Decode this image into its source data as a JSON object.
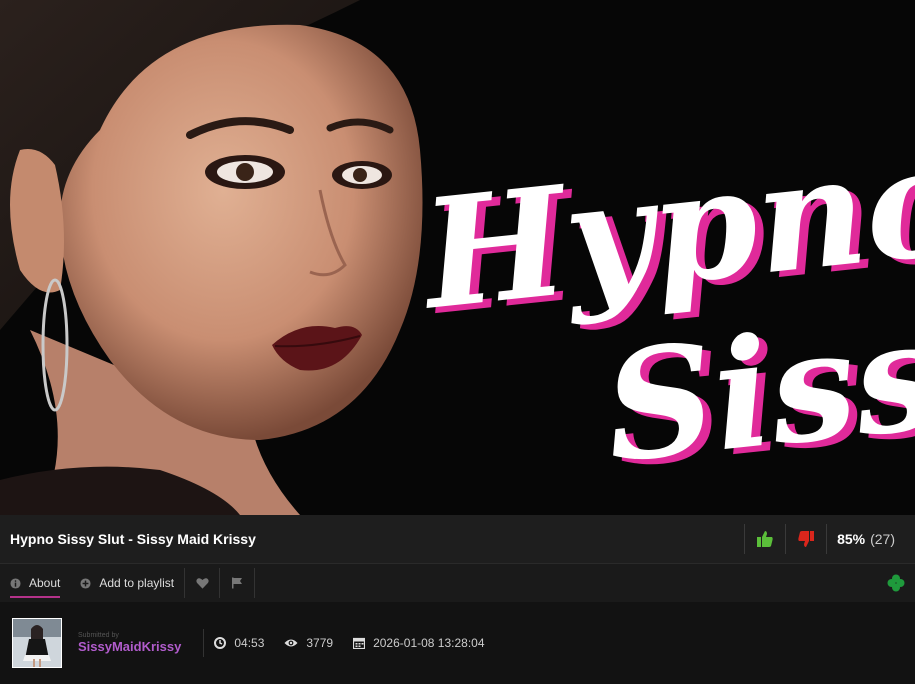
{
  "video": {
    "title": "Hypno Sissy Slut - Sissy Maid Krissy",
    "thumbnail_text_line1": "Hypno",
    "thumbnail_text_line2": "Sissy"
  },
  "rating": {
    "percent": "85%",
    "count": "(27)"
  },
  "tabs": {
    "about": "About",
    "add_to_playlist": "Add to playlist"
  },
  "submitter": {
    "submitted_by_label": "Submitted by",
    "username": "SissyMaidKrissy"
  },
  "meta": {
    "duration": "04:53",
    "views": "3779",
    "date": "2026-01-08 13:28:04"
  },
  "colors": {
    "accent": "#b4328a",
    "username": "#b15ccc",
    "thumbs_up": "#5bbf3a",
    "thumbs_down": "#d9261c",
    "clover": "#1f9a3c"
  }
}
